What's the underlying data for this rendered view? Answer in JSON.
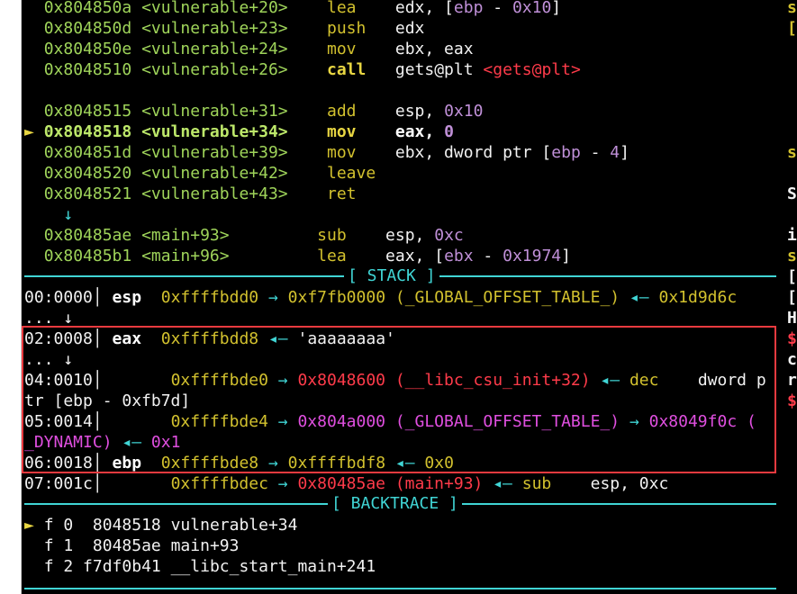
{
  "disasm": [
    {
      "addr": "0x804850a",
      "sym": "<vulnerable+20>",
      "op": "lea",
      "args": "edx, [ebp - 0x10]"
    },
    {
      "addr": "0x804850d",
      "sym": "<vulnerable+23>",
      "op": "push",
      "args": "edx"
    },
    {
      "addr": "0x804850e",
      "sym": "<vulnerable+24>",
      "op": "mov",
      "args": "ebx, eax"
    },
    {
      "addr": "0x8048510",
      "sym": "<vulnerable+26>",
      "op": "call",
      "args": "gets@plt",
      "args2": "<gets@plt>"
    },
    {
      "addr": "0x8048515",
      "sym": "<vulnerable+31>",
      "op": "add",
      "args": "esp, 0x10"
    },
    {
      "addr": "0x8048518",
      "sym": "<vulnerable+34>",
      "op": "mov",
      "args": "eax, 0",
      "current": true,
      "marker": "►"
    },
    {
      "addr": "0x804851d",
      "sym": "<vulnerable+39>",
      "op": "mov",
      "args": "ebx, dword ptr [ebp - 4]"
    },
    {
      "addr": "0x8048520",
      "sym": "<vulnerable+42>",
      "op": "leave",
      "args": ""
    },
    {
      "addr": "0x8048521",
      "sym": "<vulnerable+43>",
      "op": "ret",
      "args": ""
    },
    {
      "arrow": "↓"
    },
    {
      "addr": "0x80485ae",
      "sym": "<main+93>",
      "op": "sub",
      "args": "esp, 0xc"
    },
    {
      "addr": "0x80485b1",
      "sym": "<main+96>",
      "op": "lea",
      "args": "eax, [ebx - 0x1974]"
    }
  ],
  "stack_title": "[ STACK ]",
  "stack": {
    "r0": {
      "off": "00:0000",
      "reg": "esp",
      "addr": "0xffffbdd0",
      "a1": "→",
      "v1": "0xf7fb0000 (_GLOBAL_OFFSET_TABLE_)",
      "a2": "◂—",
      "v2": "0x1d9d6c"
    },
    "skip1": "... ↓",
    "r2": {
      "off": "02:0008",
      "reg": "eax",
      "addr": "0xffffbdd8",
      "a1": "◂—",
      "v1": "'aaaaaaaa'"
    },
    "skip2": "... ↓",
    "r4": {
      "off": "04:0010",
      "addr": "0xffffbde0",
      "a1": "→",
      "v1": "0x8048600 (__libc_csu_init+32)",
      "a2": "◂—",
      "op": "dec",
      "args": "dword p",
      "wrap": "tr [ebp - 0xfb7d]"
    },
    "r5": {
      "off": "05:0014",
      "addr": "0xffffbde4",
      "a1": "→",
      "v1": "0x804a000 (_GLOBAL_OFFSET_TABLE_)",
      "a2": "→",
      "v2": "0x8049f0c (",
      "wrap": "_DYNAMIC)",
      "a3": "◂—",
      "v3": "0x1"
    },
    "r6": {
      "off": "06:0018",
      "reg": "ebp",
      "addr": "0xffffbde8",
      "a1": "→",
      "v1": "0xffffbdf8",
      "a2": "◂—",
      "v2": "0x0"
    },
    "r7": {
      "off": "07:001c",
      "addr": "0xffffbdec",
      "a1": "→",
      "v1": "0x80485ae (main+93)",
      "a2": "◂—",
      "op": "sub",
      "args": "esp, 0xc"
    }
  },
  "backtrace_title": "[ BACKTRACE ]",
  "backtrace": [
    {
      "marker": "►",
      "frame": "f 0",
      "addr": "8048518",
      "sym": "vulnerable+34"
    },
    {
      "marker": "",
      "frame": "f 1",
      "addr": "80485ae",
      "sym": "main+93"
    },
    {
      "marker": "",
      "frame": "f 2",
      "addr": "f7df0b41",
      "sym": "__libc_start_main+241"
    }
  ],
  "right_chars": [
    "s",
    "[",
    "",
    "",
    "",
    "",
    "",
    "s",
    "",
    "S",
    "",
    "i",
    "s",
    "[",
    "[",
    "H",
    "$",
    "c",
    "r",
    "$"
  ],
  "colors": {
    "accent": "#40d5d5",
    "address": "#9fd45a",
    "mnemonic": "#d2c12e",
    "highlight_box": "#ea3a3f"
  }
}
